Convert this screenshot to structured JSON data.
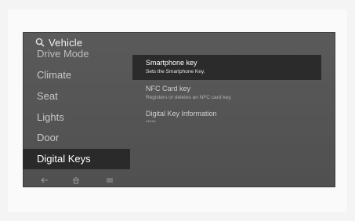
{
  "header": {
    "title": "Vehicle"
  },
  "sidebar": {
    "items": [
      {
        "label": "Drive Mode"
      },
      {
        "label": "Climate"
      },
      {
        "label": "Seat"
      },
      {
        "label": "Lights"
      },
      {
        "label": "Door"
      },
      {
        "label": "Digital Keys"
      }
    ]
  },
  "content": {
    "items": [
      {
        "title": "Smartphone key",
        "subtitle": "Sets the Smartphone Key."
      },
      {
        "title": "NFC Card key",
        "subtitle": "Registers or deletes an NFC card key."
      },
      {
        "title": "Digital Key Information",
        "subtitle": "*****"
      }
    ]
  },
  "icons": {
    "search": "search-icon",
    "back": "back-icon",
    "home": "home-icon",
    "menu": "menu-icon"
  },
  "colors": {
    "screen_bg": "#555555",
    "selected_bg": "#2a2a2a",
    "text": "#ffffff"
  }
}
